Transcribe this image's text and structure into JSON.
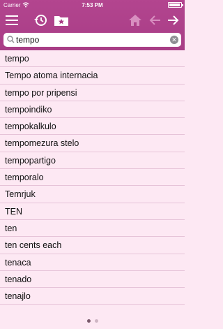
{
  "status_bar": {
    "carrier": "Carrier",
    "time": "7:53 PM",
    "battery_level": 0.95
  },
  "toolbar": {
    "icons": [
      "hamburger-menu-icon",
      "history-clock-icon",
      "favorites-folder-star-icon",
      "home-icon",
      "arrow-left-icon",
      "arrow-right-icon"
    ],
    "back_enabled": false,
    "home_enabled": false
  },
  "search": {
    "value": "tempo",
    "placeholder": ""
  },
  "results": [
    {
      "text": "tempo"
    },
    {
      "text": "Tempo atoma internacia"
    },
    {
      "text": "tempo por pripensi"
    },
    {
      "text": "tempoindiko"
    },
    {
      "text": "tempokalkulo"
    },
    {
      "text": "tempomezura stelo"
    },
    {
      "text": "tempopartigo"
    },
    {
      "text": "temporalo"
    },
    {
      "text": "Temrjuk"
    },
    {
      "text": "TEN"
    },
    {
      "text": "ten"
    },
    {
      "text": "ten cents each"
    },
    {
      "text": "tenaca"
    },
    {
      "text": "tenado"
    },
    {
      "text": "tenajlo"
    }
  ],
  "pager": {
    "pages": 2,
    "current": 1
  },
  "colors": {
    "header": "#a83d86",
    "background": "#fde8f3",
    "divider": "#e6c3d8",
    "icon_disabled": "#d88fc0"
  }
}
